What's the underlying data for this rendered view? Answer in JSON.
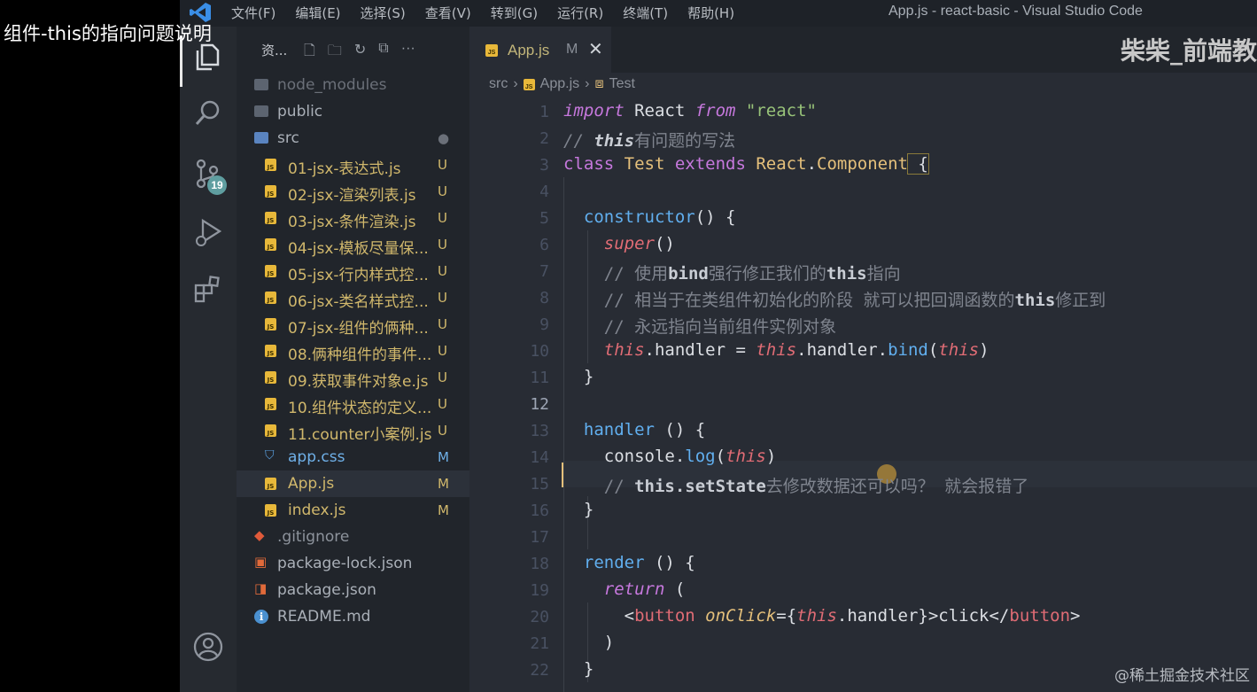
{
  "overlay_title": "组件-this的指向问题说明",
  "menu": [
    "文件(F)",
    "编辑(E)",
    "选择(S)",
    "查看(V)",
    "转到(G)",
    "运行(R)",
    "终端(T)",
    "帮助(H)"
  ],
  "window_title": "App.js - react-basic - Visual Studio Code",
  "scm_badge": "19",
  "explorer_title": "资...",
  "files": [
    {
      "name": "node_modules",
      "status": "",
      "type": "folder"
    },
    {
      "name": "public",
      "status": "",
      "type": "folder"
    },
    {
      "name": "src",
      "status": "●",
      "type": "folder-open"
    },
    {
      "name": "01-jsx-表达式.js",
      "status": "U",
      "type": "js"
    },
    {
      "name": "02-jsx-渲染列表.js",
      "status": "U",
      "type": "js"
    },
    {
      "name": "03-jsx-条件渲染.js",
      "status": "U",
      "type": "js"
    },
    {
      "name": "04-jsx-模板尽量保...",
      "status": "U",
      "type": "js"
    },
    {
      "name": "05-jsx-行内样式控...",
      "status": "U",
      "type": "js"
    },
    {
      "name": "06-jsx-类名样式控...",
      "status": "U",
      "type": "js"
    },
    {
      "name": "07-jsx-组件的俩种...",
      "status": "U",
      "type": "js"
    },
    {
      "name": "08.俩种组件的事件...",
      "status": "U",
      "type": "js"
    },
    {
      "name": "09.获取事件对象e.js",
      "status": "U",
      "type": "js"
    },
    {
      "name": "10.组件状态的定义...",
      "status": "U",
      "type": "js"
    },
    {
      "name": "11.counter小案例.js",
      "status": "U",
      "type": "js"
    },
    {
      "name": "app.css",
      "status": "M",
      "type": "css"
    },
    {
      "name": "App.js",
      "status": "M",
      "type": "js"
    },
    {
      "name": "index.js",
      "status": "M",
      "type": "js"
    },
    {
      "name": ".gitignore",
      "status": "",
      "type": "git"
    },
    {
      "name": "package-lock.json",
      "status": "",
      "type": "lock"
    },
    {
      "name": "package.json",
      "status": "",
      "type": "pkg"
    },
    {
      "name": "README.md",
      "status": "",
      "type": "info"
    }
  ],
  "tab": {
    "label": "App.js",
    "modified": "M",
    "close": "✕"
  },
  "channel_watermark": "柴柴_前端教",
  "breadcrumbs": [
    "src",
    "App.js",
    "Test"
  ],
  "current_line": "12",
  "line_numbers": [
    "1",
    "2",
    "3",
    "4",
    "5",
    "6",
    "7",
    "8",
    "9",
    "10",
    "11",
    "12",
    "13",
    "14",
    "15",
    "16",
    "17",
    "18",
    "19",
    "20",
    "21",
    "22"
  ],
  "code": {
    "l1": [
      "import",
      " React ",
      "from",
      " \"react\""
    ],
    "l2": [
      "// ",
      "this",
      "有问题的写法"
    ],
    "l3": [
      "class",
      " Test ",
      "extends",
      " React",
      ".",
      "Component",
      " {"
    ],
    "l5": [
      "  constructor",
      "() {"
    ],
    "l6": [
      "    super",
      "()"
    ],
    "l7": [
      "    // 使用",
      "bind",
      "强行修正我们的",
      "this",
      "指向"
    ],
    "l8": [
      "    // 相当于在类组件初始化的阶段 就可以把回调函数的",
      "this",
      "修正到"
    ],
    "l9": [
      "    // 永远指向当前组件实例对象"
    ],
    "l10": [
      "    this",
      ".handler = ",
      "this",
      ".handler.",
      "bind",
      "(",
      "this",
      ")"
    ],
    "l11": [
      "  }"
    ],
    "l13": [
      "  handler",
      " () {"
    ],
    "l14": [
      "    console.",
      "log",
      "(",
      "this",
      ")"
    ],
    "l15": [
      "    // ",
      "this.setState",
      "去修改数据还可以吗？ 就会报错了"
    ],
    "l16": [
      "  }"
    ],
    "l18": [
      "  render",
      " () {"
    ],
    "l19": [
      "    return",
      " ("
    ],
    "l20": [
      "      <",
      "button",
      " ",
      "onClick",
      "={",
      "this",
      ".handler}>click</",
      "button",
      ">"
    ],
    "l21": [
      "    )"
    ],
    "l22": [
      "  }"
    ]
  },
  "footer_watermark": "@稀土掘金技术社区"
}
